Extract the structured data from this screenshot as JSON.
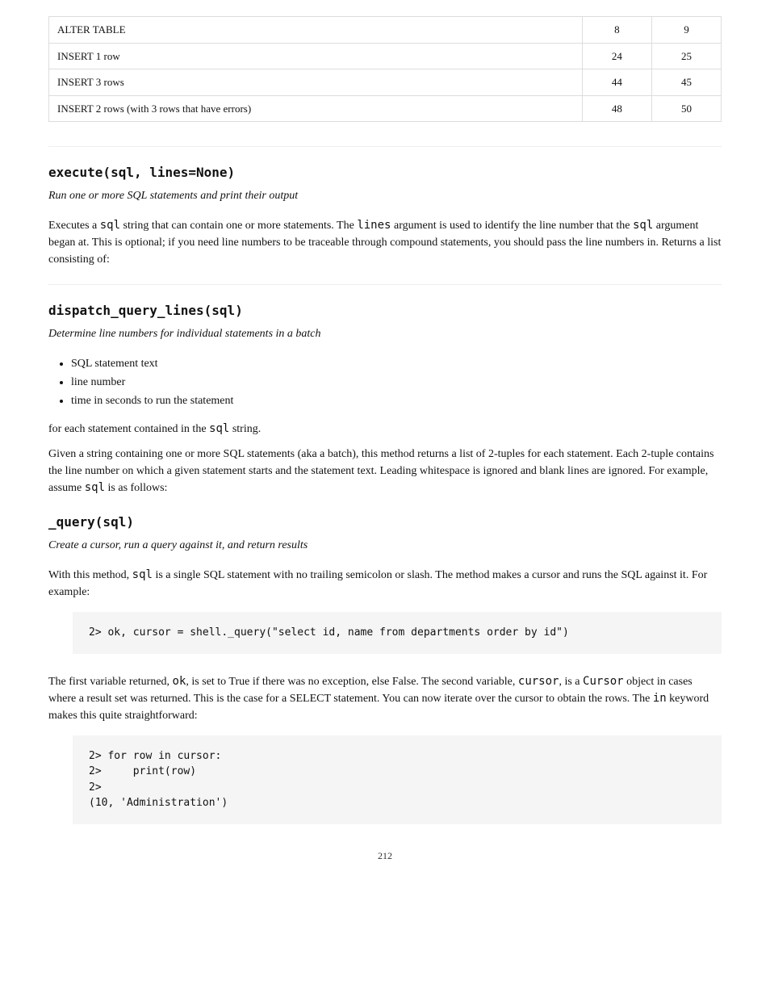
{
  "table": {
    "rows": [
      [
        "ALTER TABLE",
        "8",
        "9"
      ],
      [
        "INSERT 1 row",
        "24",
        "25"
      ],
      [
        "INSERT 3 rows",
        "44",
        "45"
      ],
      [
        "INSERT 2 rows (with 3 rows that have errors)",
        "48",
        "50"
      ]
    ]
  },
  "method1": {
    "name": "dispatch_query_lines(sql)",
    "subtitle": "Determine line numbers for individual statements in a batch",
    "p1_pre": "Given a string containing one or more SQL statements (aka a batch), this method returns a list of 2-tuples for each statement. Each 2-tuple contains the line number on which a given statement starts and the statement text. Leading whitespace is ignored and blank lines are ignored. For example, assume ",
    "p1_code": "sql",
    "p1_post": " is as follows:",
    "method2": {
      "name": "execute(sql, lines=None)",
      "subtitle": "Run one or more SQL statements and print their output",
      "p1_prefix": "Executes a ",
      "p1_code1": "sql",
      "p1_mid1": " string that can contain one or more statements. The ",
      "p1_code2": "lines",
      "p1_mid2": " argument is used to identify the line number that the ",
      "p1_code3": "sql",
      "p1_post1": " argument began at. This is optional; if you need line numbers to be traceable through compound statements, you should pass the line numbers in. Returns a list consisting of:"
    },
    "bullets": [
      "SQL statement text",
      "line number",
      "time in seconds to run the statement"
    ],
    "p2": "for each statement contained in the ",
    "p2_code": "sql",
    "p2_post": " string.",
    "method3": {
      "name": "_query(sql)",
      "subtitle": "Create a cursor, run a query against it, and return results",
      "p1_prefix": "With this method, ",
      "p1_code": "sql",
      "p1_post": " is a single SQL statement with no trailing semicolon or slash. The method makes a cursor and runs the SQL against it. For example:"
    },
    "code1": "2> ok, cursor = shell._query(\"select id, name from departments order by id\")",
    "p3_prefix": "The first variable returned, ",
    "p3_code1": "ok",
    "p3_mid1": ", is set to True if there was no exception, else False. The second variable, ",
    "p3_code2": "cursor",
    "p3_mid2": ", is a ",
    "p3_code3": "Cursor",
    "p3_mid3": " object in cases where a result set was returned. This is the case for a SELECT statement. You can now iterate over the cursor to obtain the rows. The ",
    "p3_code4": "in",
    "p3_post": " keyword makes this quite straightforward:",
    "code2": "2> for row in cursor:\n2>     print(row)\n2>\n(10, 'Administration')"
  },
  "pageNumber": "212"
}
